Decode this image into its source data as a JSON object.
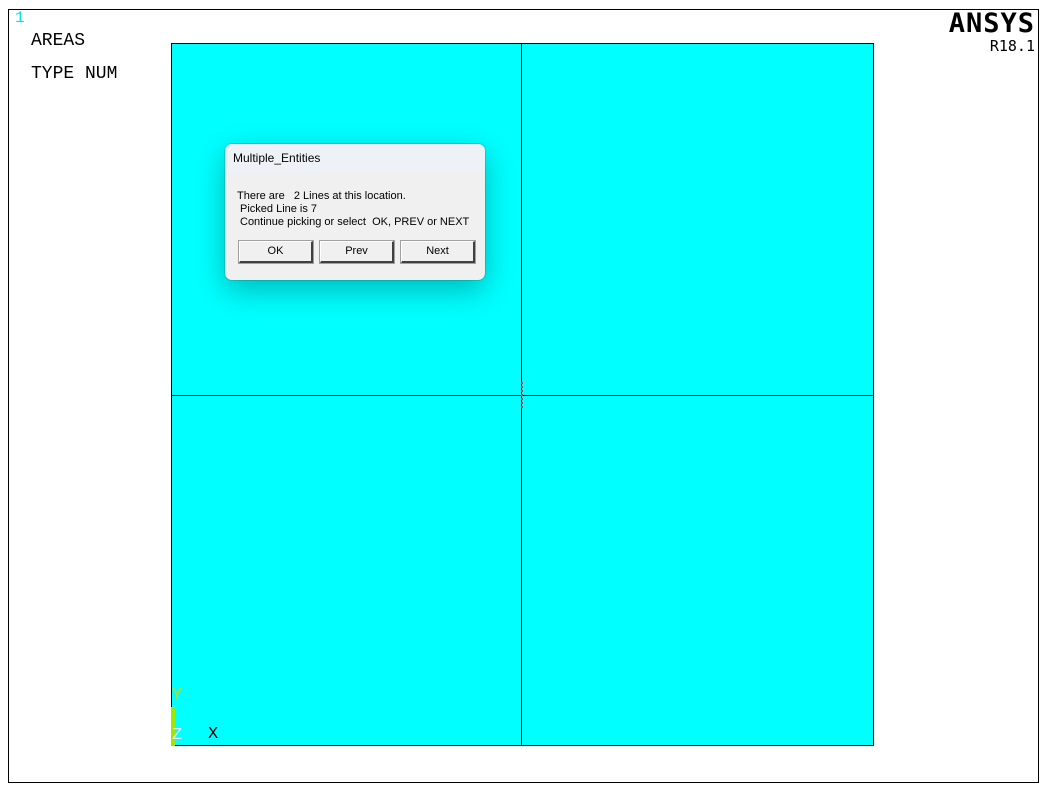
{
  "window": {
    "number": "1",
    "logo": "ANSYS",
    "release": "R18.1"
  },
  "plot_labels": [
    "AREAS",
    "TYPE NUM"
  ],
  "triad": {
    "y_label": "Y",
    "z_label": "Z",
    "x_label": "X"
  },
  "colors": {
    "area_fill": "#00ffff",
    "window_number": "#00e5e5",
    "triad_y": "#9be800",
    "triad_z": "#ffffff"
  },
  "dialog": {
    "title": "Multiple_Entities",
    "message_lines": [
      "There are   2 Lines at this location.",
      "Picked Line is 7",
      "Continue picking or select  OK, PREV or NEXT"
    ],
    "buttons": {
      "ok": "OK",
      "prev": "Prev",
      "next": "Next"
    }
  }
}
